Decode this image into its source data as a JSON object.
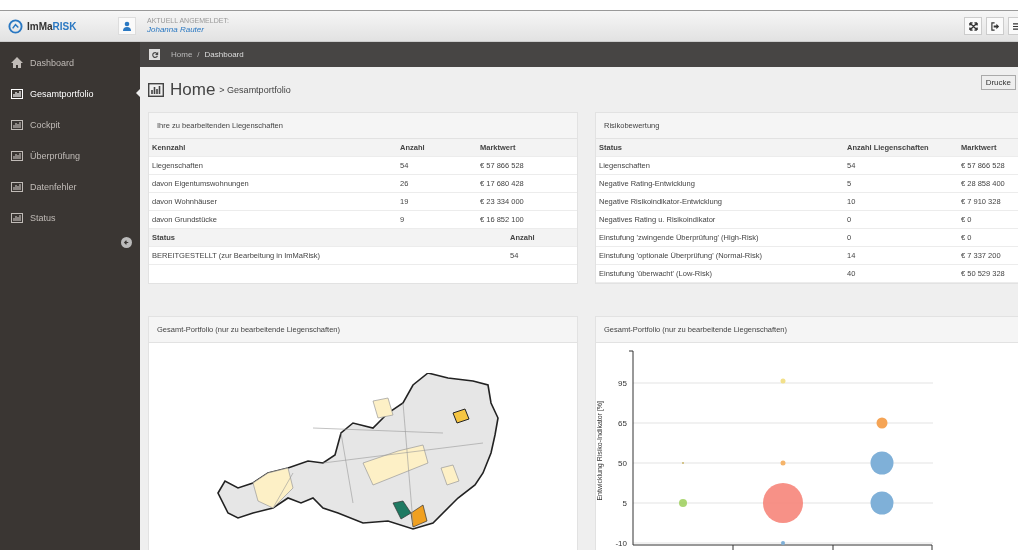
{
  "header": {
    "logo": "ImMa",
    "logo_accent": "RISK",
    "user_caption": "AKTUELL ANGEMELDET:",
    "user_name": "Johanna Rauter"
  },
  "sidebar": {
    "items": [
      {
        "label": "Dashboard",
        "selected": false
      },
      {
        "label": "Gesamtportfolio",
        "selected": true
      },
      {
        "label": "Cockpit",
        "selected": false
      },
      {
        "label": "Überprüfung",
        "selected": false
      },
      {
        "label": "Datenfehler",
        "selected": false
      },
      {
        "label": "Status",
        "selected": false
      }
    ]
  },
  "breadcrumb": [
    "Home",
    "/",
    "Dashboard"
  ],
  "page_title": {
    "main": "Home",
    "sub": "> Gesamtportfolio"
  },
  "print_button": "Drucke",
  "properties_panel": {
    "title": "Ihre zu bearbeitenden Liegenschaften",
    "columns": [
      "Kennzahl",
      "Anzahl",
      "Marktwert"
    ],
    "rows": [
      [
        "Liegenschaften",
        "54",
        "€ 57 866 528"
      ],
      [
        "davon Eigentumswohnungen",
        "26",
        "€ 17 680 428"
      ],
      [
        "davon Wohnhäuser",
        "19",
        "€ 23 334 000"
      ],
      [
        "davon Grundstücke",
        "9",
        "€ 16 852 100"
      ]
    ],
    "status_columns": [
      "Status",
      "Anzahl"
    ],
    "status_rows": [
      [
        "BEREITGESTELLT (zur Bearbeitung in ImMaRisk)",
        "54"
      ]
    ]
  },
  "risk_panel": {
    "title": "Risikobewertung",
    "columns": [
      "Status",
      "Anzahl Liegenschaften",
      "Marktwert"
    ],
    "rows": [
      [
        "Liegenschaften",
        "54",
        "€ 57 866 528"
      ],
      [
        "Negative Rating-Entwicklung",
        "5",
        "€ 28 858 400"
      ],
      [
        "Negative Risikoindikator-Entwicklung",
        "10",
        "€ 7 910 328"
      ],
      [
        "Negatives Rating u. Risikoindikator",
        "0",
        "€ 0"
      ],
      [
        "Einstufung 'zwingende Überprüfung' (High-Risk)",
        "0",
        "€ 0"
      ],
      [
        "Einstufung 'optionale Überprüfung' (Normal-Risk)",
        "14",
        "€ 7 337 200"
      ],
      [
        "Einstufung 'überwacht' (Low-Risk)",
        "40",
        "€ 50 529 328"
      ]
    ]
  },
  "map_panel": {
    "title": "Gesamt-Portfolio (nur zu bearbeitende Liegenschaften)"
  },
  "bubble_panel": {
    "title": "Gesamt-Portfolio (nur zu bearbeitende Liegenschaften)",
    "ylabel": "Entwicklung Risiko-Indikator [%]",
    "yticks": [
      "95",
      "65",
      "50",
      "5",
      "-10"
    ]
  }
}
